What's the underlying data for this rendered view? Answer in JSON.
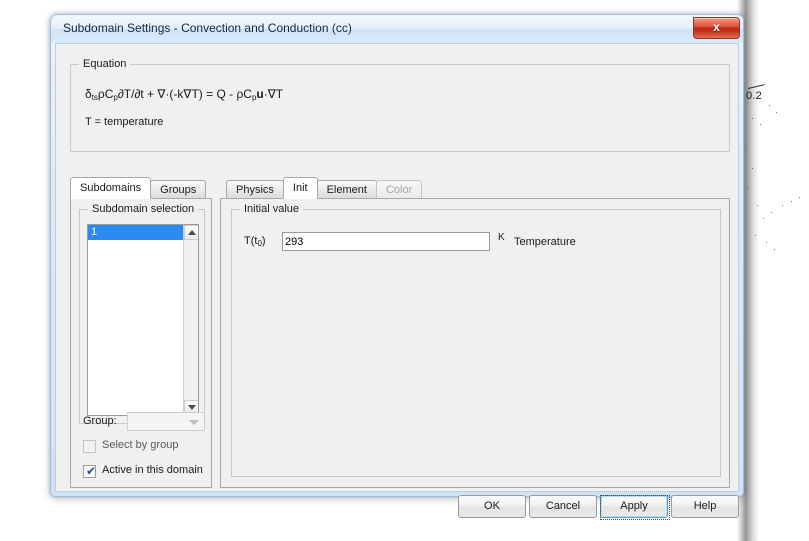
{
  "background": {
    "tick_label": "0.2"
  },
  "dialog": {
    "title": "Subdomain Settings - Convection and Conduction (cc)",
    "close_icon": "close-icon",
    "close_glyph": "x"
  },
  "equation": {
    "group_title": "Equation",
    "formula_text": "δts ρCp ∂T/∂t + ∇·(-k∇T) = Q - ρCp u·∇T",
    "formula_parts": {
      "delta": "δ",
      "delta_sub": "ts",
      "rho_cp": "ρC",
      "cp_sub": "p",
      "partial": "∂T/∂t + ∇·(-k∇T) = Q - ρC",
      "cp_sub2": "p",
      "u": "u",
      "tail": "·∇T"
    },
    "description": "T = temperature"
  },
  "left_tabs": [
    {
      "label": "Subdomains",
      "active": true,
      "disabled": false
    },
    {
      "label": "Groups",
      "active": false,
      "disabled": false
    }
  ],
  "right_tabs": [
    {
      "label": "Physics",
      "active": false,
      "disabled": false
    },
    {
      "label": "Init",
      "active": true,
      "disabled": false
    },
    {
      "label": "Element",
      "active": false,
      "disabled": false
    },
    {
      "label": "Color",
      "active": false,
      "disabled": true
    }
  ],
  "subdomain": {
    "group_title": "Subdomain selection",
    "items": [
      {
        "label": "1",
        "selected": true
      }
    ],
    "scroll_up_icon": "scroll-up-arrow-icon",
    "scroll_down_icon": "scroll-down-arrow-icon",
    "group_label": "Group:",
    "group_value": "",
    "group_dropdown_icon": "chevron-down-icon",
    "checkbox_select_by_group": {
      "label": "Select by group",
      "checked": false
    },
    "checkbox_active_in_domain": {
      "label": "Active in this domain",
      "checked": true,
      "check_glyph": "✔"
    }
  },
  "initial_value": {
    "group_title": "Initial value",
    "field_label_prefix": "T(t",
    "field_label_sub": "0",
    "field_label_suffix": ")",
    "value": "293",
    "unit": "K",
    "description": "Temperature"
  },
  "buttons": {
    "ok": "OK",
    "cancel": "Cancel",
    "apply": "Apply",
    "help": "Help"
  },
  "colors": {
    "title_bar_accent": "#cfe3f6",
    "selection_blue": "#2a8aef",
    "close_red": "#bc2413",
    "focus_blue": "#4a9fd4",
    "dialog_face": "#f0f0f0"
  }
}
